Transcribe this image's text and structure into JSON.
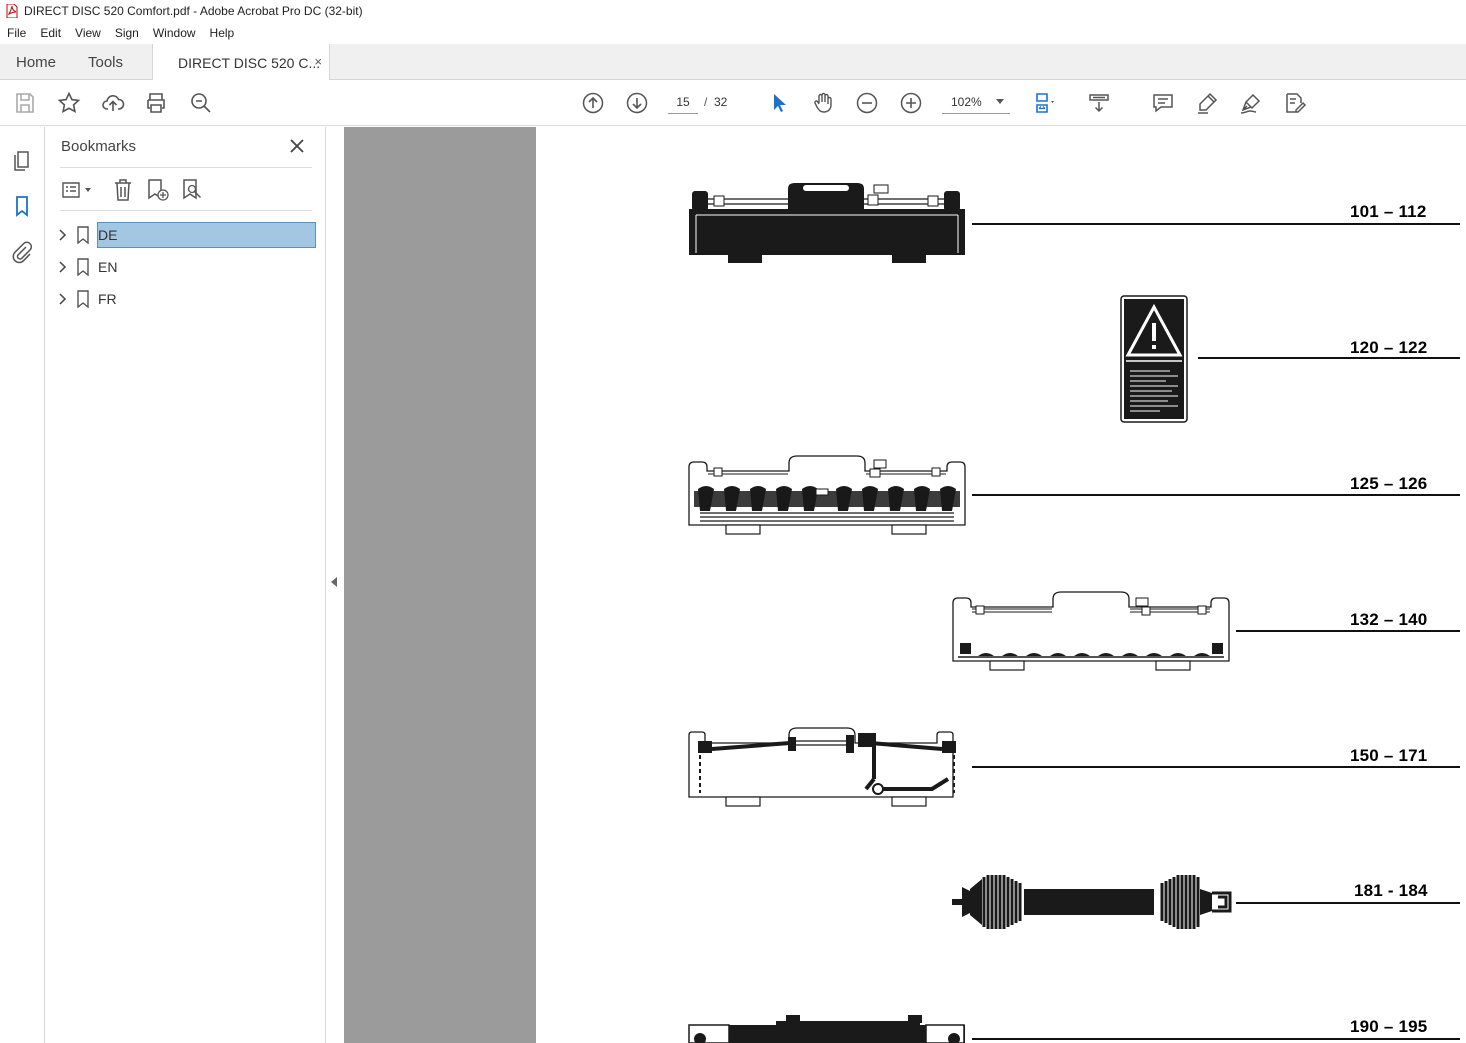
{
  "window": {
    "title": "DIRECT DISC 520 Comfort.pdf - Adobe Acrobat Pro DC (32-bit)"
  },
  "menu": [
    "File",
    "Edit",
    "View",
    "Sign",
    "Window",
    "Help"
  ],
  "tabs": {
    "home": "Home",
    "tools": "Tools",
    "document": "DIRECT DISC 520 C...",
    "close_symbol": "×"
  },
  "toolbar": {
    "current_page": "15",
    "page_separator": "/",
    "total_pages": "32",
    "zoom": "102%",
    "icons": [
      "save-icon",
      "bookmark-star-icon",
      "upload-cloud-icon",
      "print-icon",
      "zoom-search-icon",
      "page-up-icon",
      "page-down-icon",
      "select-cursor-icon",
      "hand-icon",
      "zoom-out-icon",
      "zoom-in-icon",
      "fit-page-icon",
      "scroll-mode-icon",
      "comment-icon",
      "highlight-icon",
      "sign-icon",
      "fill-sign-icon"
    ],
    "accent_color": "#1a73c8"
  },
  "panel": {
    "title": "Bookmarks",
    "bookmarks": [
      {
        "label": "DE",
        "selected": true
      },
      {
        "label": "EN",
        "selected": false
      },
      {
        "label": "FR",
        "selected": false
      }
    ]
  },
  "document": {
    "entries": [
      {
        "label": "101 – 112",
        "illustration": "machine-top-view-solid"
      },
      {
        "label": "120 – 122",
        "illustration": "warning-label"
      },
      {
        "label": "125 – 126",
        "illustration": "machine-discs-view"
      },
      {
        "label": "132 – 140",
        "illustration": "machine-outline-view"
      },
      {
        "label": "150 – 171",
        "illustration": "machine-hydraulics-view"
      },
      {
        "label": "181 - 184",
        "illustration": "pto-shaft"
      },
      {
        "label": "190 – 195",
        "illustration": "machine-partial-view"
      }
    ]
  }
}
